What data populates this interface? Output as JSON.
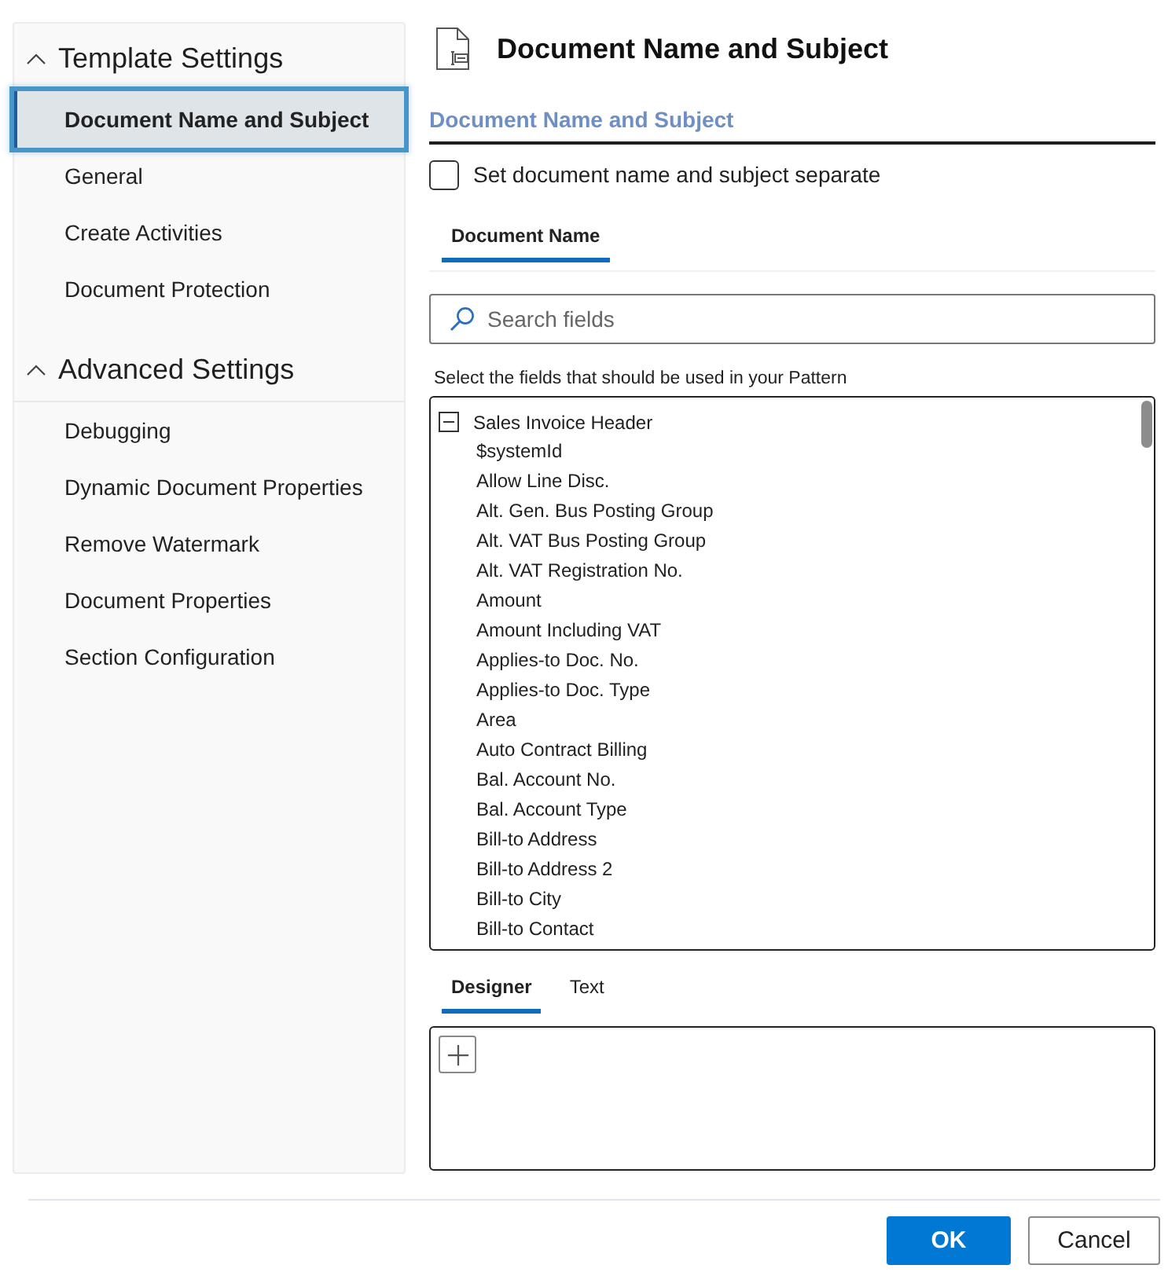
{
  "sidebar": {
    "sections": [
      {
        "title": "Template Settings",
        "expanded": true,
        "items": [
          {
            "label": "Document Name and Subject",
            "selected": true
          },
          {
            "label": "General",
            "selected": false
          },
          {
            "label": "Create Activities",
            "selected": false
          },
          {
            "label": "Document Protection",
            "selected": false
          }
        ]
      },
      {
        "title": "Advanced Settings",
        "expanded": true,
        "items": [
          {
            "label": "Debugging",
            "selected": false
          },
          {
            "label": "Dynamic Document Properties",
            "selected": false
          },
          {
            "label": "Remove Watermark",
            "selected": false
          },
          {
            "label": "Document Properties",
            "selected": false
          },
          {
            "label": "Section Configuration",
            "selected": false
          }
        ]
      }
    ]
  },
  "header": {
    "title": "Document Name and Subject"
  },
  "section": {
    "title": "Document Name and Subject"
  },
  "checkbox": {
    "label": "Set document name and subject separate",
    "checked": false
  },
  "name_tabs": [
    {
      "label": "Document Name",
      "selected": true
    }
  ],
  "search": {
    "placeholder": "Search fields"
  },
  "field_list": {
    "caption": "Select the fields that should be used in your Pattern",
    "nodes": [
      {
        "label": "Sales Invoice Header",
        "expanded": true,
        "children": [
          {
            "label": "$systemId"
          },
          {
            "label": "Allow Line Disc."
          },
          {
            "label": "Alt. Gen. Bus Posting Group"
          },
          {
            "label": "Alt. VAT Bus Posting Group"
          },
          {
            "label": "Alt. VAT Registration No."
          },
          {
            "label": "Amount"
          },
          {
            "label": "Amount Including VAT"
          },
          {
            "label": "Applies-to Doc. No."
          },
          {
            "label": "Applies-to Doc. Type"
          },
          {
            "label": "Area"
          },
          {
            "label": "Auto Contract Billing"
          },
          {
            "label": "Bal. Account No."
          },
          {
            "label": "Bal. Account Type"
          },
          {
            "label": "Bill-to Address"
          },
          {
            "label": "Bill-to Address 2"
          },
          {
            "label": "Bill-to City"
          },
          {
            "label": "Bill-to Contact"
          }
        ]
      }
    ]
  },
  "editor_tabs": [
    {
      "label": "Designer",
      "selected": true
    },
    {
      "label": "Text",
      "selected": false
    }
  ],
  "buttons": [
    {
      "label": "OK",
      "kind": "primary"
    },
    {
      "label": "Cancel",
      "kind": "secondary"
    }
  ]
}
